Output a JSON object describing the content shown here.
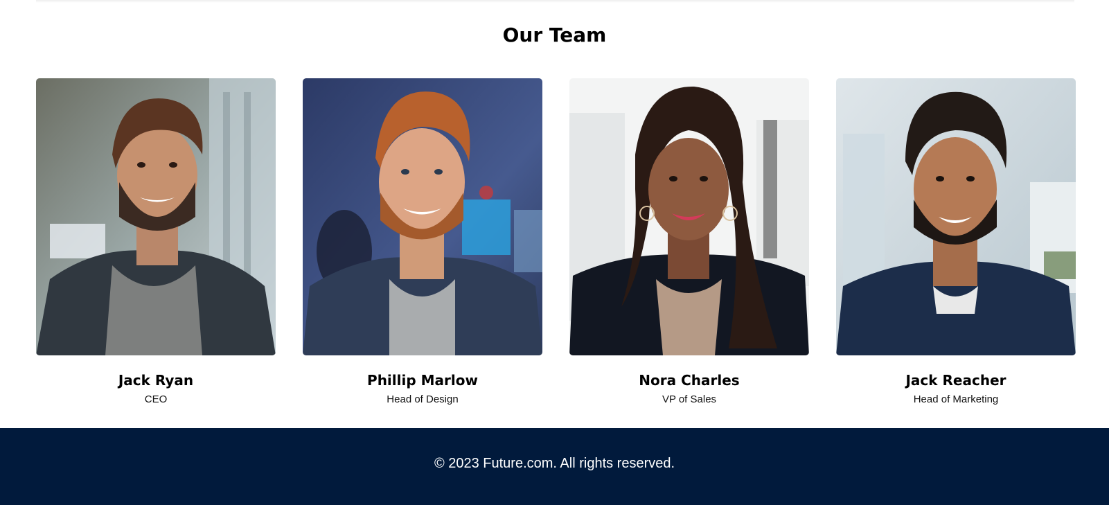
{
  "team": {
    "title": "Our Team",
    "members": [
      {
        "name": "Jack Ryan",
        "role": "CEO"
      },
      {
        "name": "Phillip Marlow",
        "role": "Head of Design"
      },
      {
        "name": "Nora Charles",
        "role": "VP of Sales"
      },
      {
        "name": "Jack Reacher",
        "role": "Head of Marketing"
      }
    ]
  },
  "footer": {
    "copyright": "© 2023 Future.com. All rights reserved."
  },
  "colors": {
    "footer_bg": "#011a3c",
    "footer_text": "#ffffff",
    "heading": "#000000"
  }
}
